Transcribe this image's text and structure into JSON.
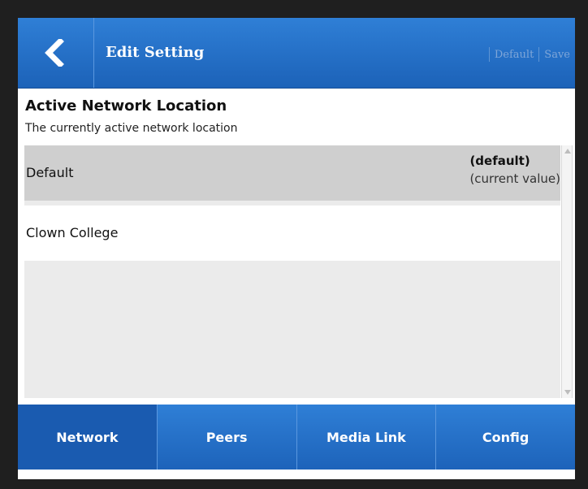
{
  "header": {
    "title": "Edit Setting",
    "default_label": "Default",
    "save_label": "Save"
  },
  "setting": {
    "title": "Active Network Location",
    "description": "The currently active network location"
  },
  "options": [
    {
      "label": "Default",
      "tag_default": "(default)",
      "tag_current": "(current value)",
      "selected": true
    },
    {
      "label": "Clown College",
      "selected": false
    }
  ],
  "tabs": [
    {
      "label": "Network",
      "active": true
    },
    {
      "label": "Peers",
      "active": false
    },
    {
      "label": "Media Link",
      "active": false
    },
    {
      "label": "Config",
      "active": false
    }
  ],
  "colors": {
    "accent": "#1c62b8",
    "selected_row": "#cfcfcf"
  }
}
